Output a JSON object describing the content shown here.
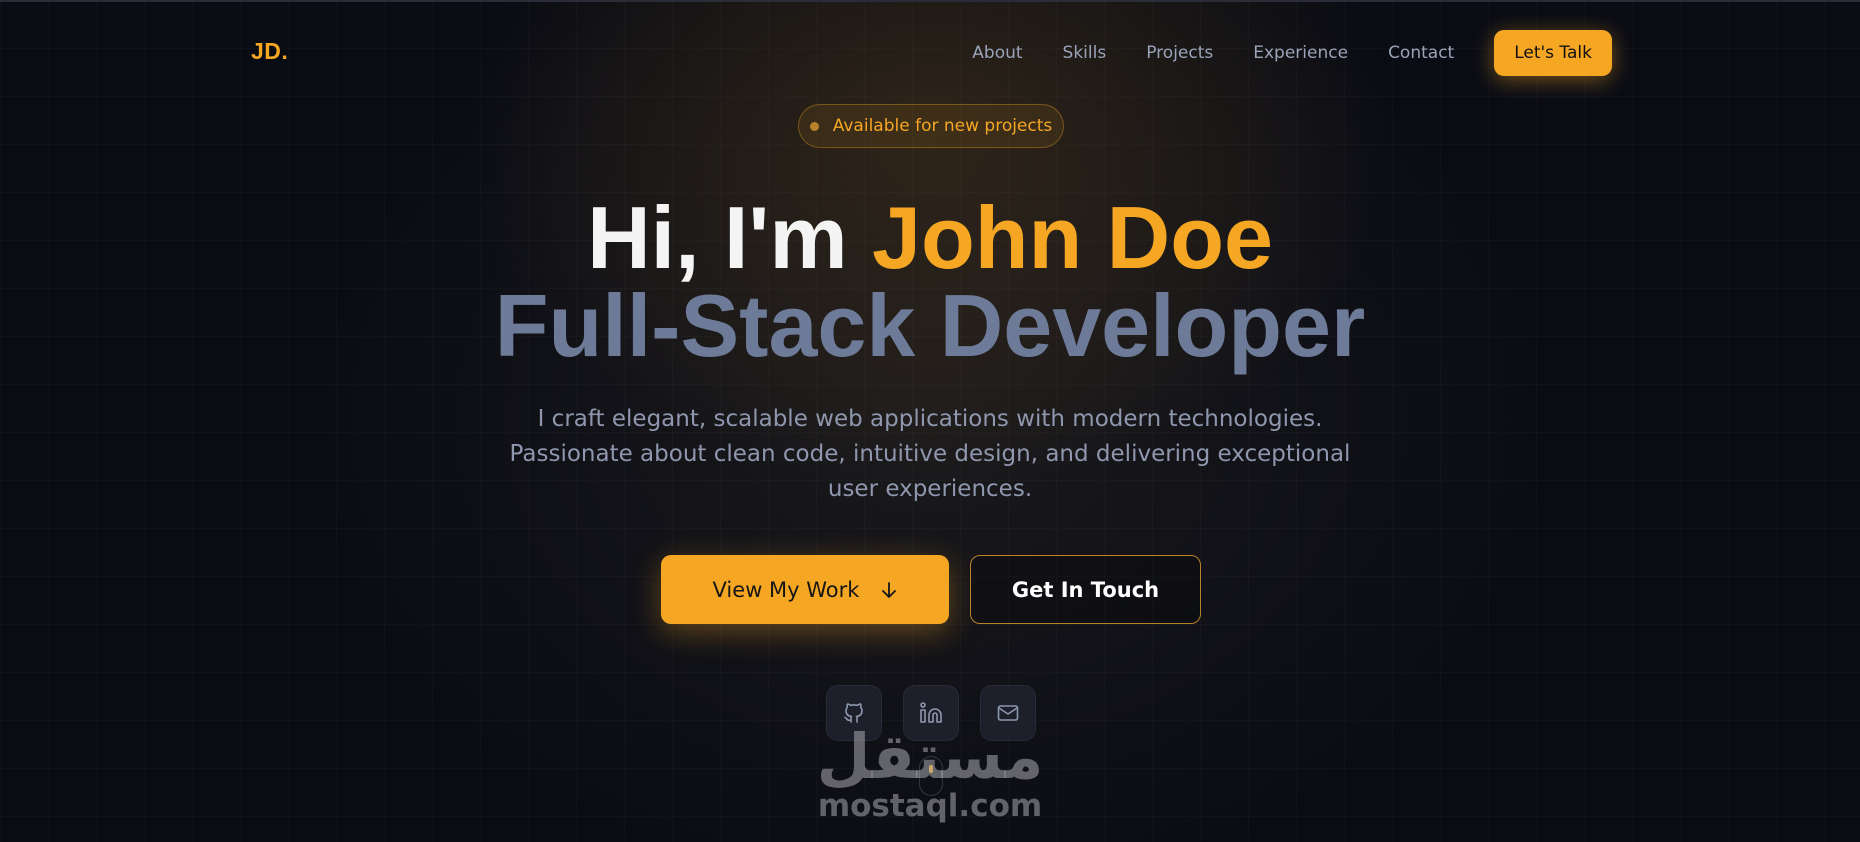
{
  "brand": {
    "logo": "JD."
  },
  "nav": {
    "links": [
      "About",
      "Skills",
      "Projects",
      "Experience",
      "Contact"
    ],
    "cta": "Let's Talk"
  },
  "hero": {
    "badge": "Available for new projects",
    "greeting": "Hi, I'm ",
    "name": "John Doe",
    "role": "Full-Stack Developer",
    "description": "I craft elegant, scalable web applications with modern technologies. Passionate about clean code, intuitive design, and delivering exceptional user experiences.",
    "primary_button": "View My Work",
    "primary_button_icon": "arrow-down-icon",
    "secondary_button": "Get In Touch"
  },
  "social": [
    "github-icon",
    "linkedin-icon",
    "mail-icon"
  ],
  "watermark": {
    "arabic": "مستقل",
    "latin": "mostaql.com"
  },
  "colors": {
    "accent": "#f5a623",
    "background": "#0a0c14",
    "muted_heading": "#6e7b98",
    "body_text": "#8e97ad"
  }
}
